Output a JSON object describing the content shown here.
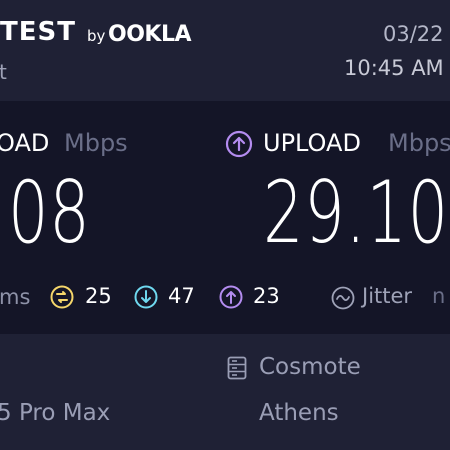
{
  "header": {
    "brand": "TEST",
    "by": "by",
    "partner": "OOKLA",
    "subtitle": "t",
    "date": "03/22",
    "time": "10:45 AM"
  },
  "download": {
    "label": "OAD",
    "unit": "Mbps",
    "value": ".08"
  },
  "upload": {
    "label": "UPLOAD",
    "unit": "Mbps",
    "value": "29.10"
  },
  "ping": {
    "unit": "ms",
    "idle": "25",
    "download": "47",
    "upload": "23"
  },
  "jitter": {
    "label": "Jitter",
    "unit": "n"
  },
  "server": {
    "name": "Cosmote",
    "city": "Athens"
  },
  "device": {
    "name": "5 Pro Max"
  },
  "colors": {
    "background": "#1f2135",
    "panel": "#141527",
    "upload_accent": "#b48cf0",
    "idle_accent": "#f5d66a",
    "download_accent": "#6fd8ef"
  }
}
